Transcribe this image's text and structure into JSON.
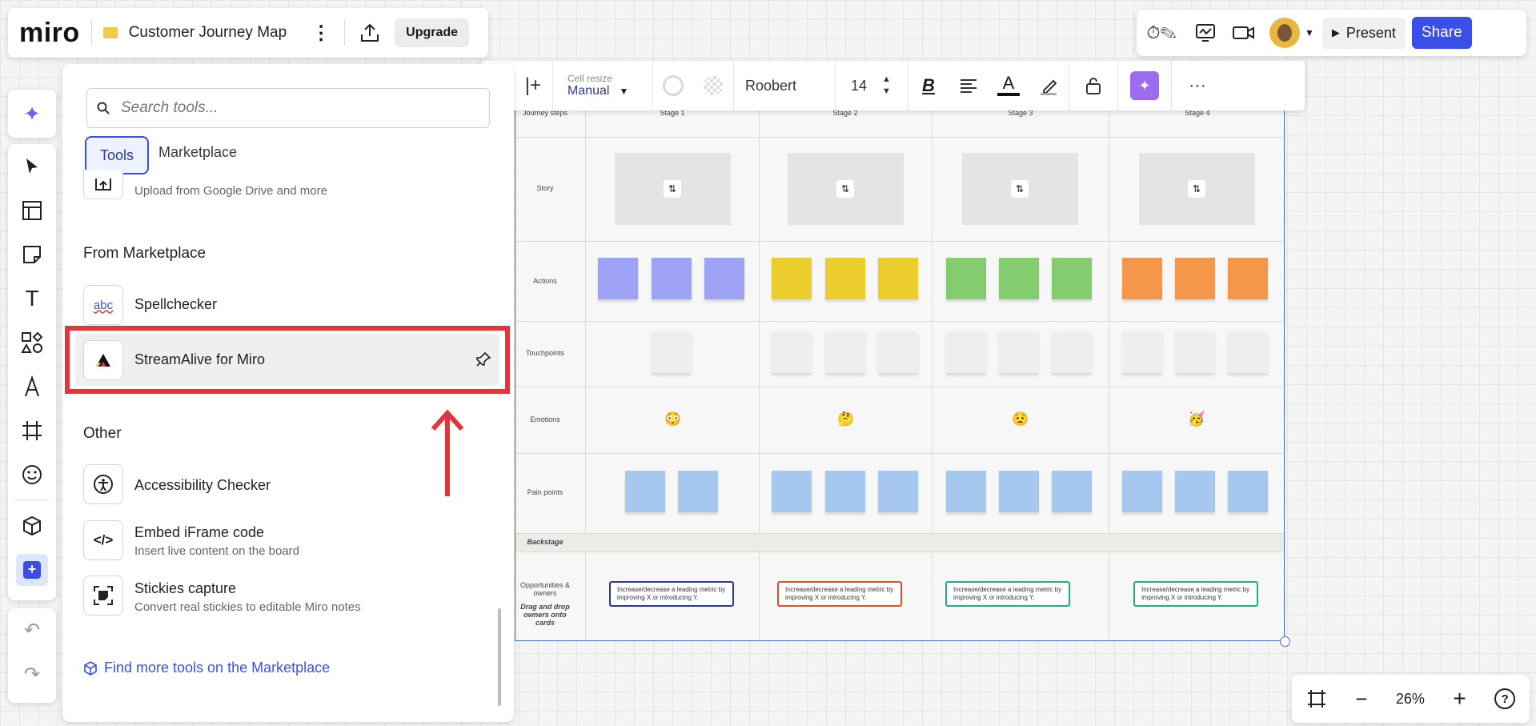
{
  "app": {
    "logo": "miro",
    "board_title": "Customer Journey Map",
    "upgrade_label": "Upgrade"
  },
  "top_right": {
    "present_label": "Present",
    "share_label": "Share"
  },
  "format_toolbar": {
    "cell_resize_label": "Cell resize",
    "cell_resize_value": "Manual",
    "font_name": "Roobert",
    "font_size": "14"
  },
  "tools_panel": {
    "search_placeholder": "Search tools...",
    "tab_tools": "Tools",
    "tab_marketplace": "Marketplace",
    "upload_sub": "Upload from Google Drive and more",
    "section_marketplace": "From Marketplace",
    "spellchecker": "Spellchecker",
    "spellchecker_icon_text": "abc",
    "streamalive": "StreamAlive for Miro",
    "section_other": "Other",
    "accessibility": "Accessibility Checker",
    "embed_title": "Embed iFrame code",
    "embed_sub": "Insert live content on the board",
    "stickies_title": "Stickies capture",
    "stickies_sub": "Convert real stickies to editable Miro notes",
    "find_more": "Find more tools on the Marketplace"
  },
  "board": {
    "header_row_label": "Journey steps",
    "stages": [
      "Stage 1",
      "Stage 2",
      "Stage 3",
      "Stage 4"
    ],
    "rows": {
      "story": "Story",
      "actions": "Actions",
      "touchpoints": "Touchpoints",
      "emotions": "Emotions",
      "pain_points": "Pain points",
      "backstage": "Backstage",
      "opportunities": "Opportunities & owners",
      "drag_hint": "Drag and drop owners onto cards"
    },
    "emotions": [
      "😳",
      "🤔",
      "😟",
      "🥳"
    ],
    "card_text": "Increase/decrease a leading metric by improving X or introducing Y.",
    "colors": {
      "actions": [
        "#9fa3f5",
        "#eccd2e",
        "#83cd6e",
        "#f4974a"
      ],
      "pain": "#a7c8ee",
      "cards": [
        "#2d3a8c",
        "#e0502c",
        "#2aa88a",
        "#2aa88a"
      ]
    }
  },
  "zoom": {
    "level": "26%"
  }
}
